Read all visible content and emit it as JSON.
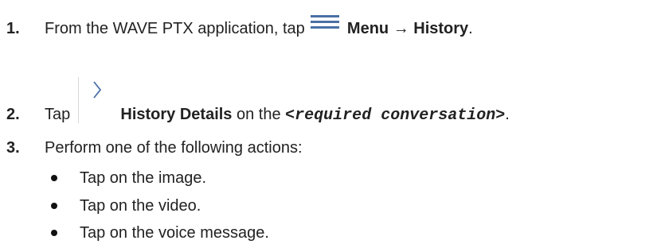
{
  "steps": [
    {
      "num": "1.",
      "text_before": "From the WAVE PTX application, tap",
      "icon": "menu-icon",
      "bold1": "Menu",
      "arrow": "→",
      "bold2": "History",
      "text_after": "."
    },
    {
      "num": "2.",
      "text_before": "Tap",
      "icon": "chevron-right-icon",
      "bold1": "History Details",
      "text_middle": "on the",
      "code": "<required conversation>",
      "text_after": "."
    },
    {
      "num": "3.",
      "text": "Perform one of the following actions:"
    }
  ],
  "bullets": [
    "Tap on the image.",
    "Tap on the video.",
    "Tap on the voice message."
  ],
  "colors": {
    "text": "#222222",
    "icon": "#4a6fa5",
    "divider": "#d8d8d8"
  }
}
